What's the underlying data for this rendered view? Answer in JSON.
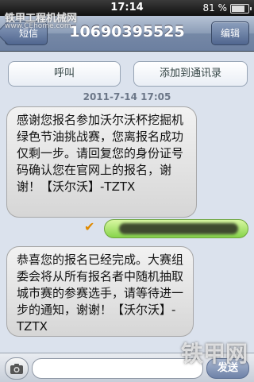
{
  "status_bar": {
    "time": "17:14",
    "battery_percent": "81 %"
  },
  "watermark": {
    "top": "铁甲工程机械网",
    "top_sub": "www.CEhome.com",
    "bottom": "铁甲网"
  },
  "navbar": {
    "back_label": "短信",
    "title": "10690395525",
    "edit_label": "编辑"
  },
  "actions": {
    "call_label": "呼叫",
    "add_contact_label": "添加到通讯录"
  },
  "conversation": {
    "timestamp": "2011-7-14  17:05",
    "messages": [
      {
        "text": "感谢您报名参加沃尔沃杯挖掘机绿色节油挑战赛，您离报名成功仅剩一步。请回复您的身份证号码确认您在官网上的报名，谢谢！【沃尔沃】-TZTX"
      },
      {
        "text": "恭喜您的报名已经完成。大赛组委会将从所有报名者中随机抽取城市赛的参赛选手，请等待进一步的通知，谢谢！【沃尔沃】-TZTX"
      }
    ]
  },
  "input_bar": {
    "send_label": "发送"
  },
  "icons": {
    "camera": "camera-icon",
    "sent_check": "checkmark-icon",
    "battery": "battery-icon"
  }
}
